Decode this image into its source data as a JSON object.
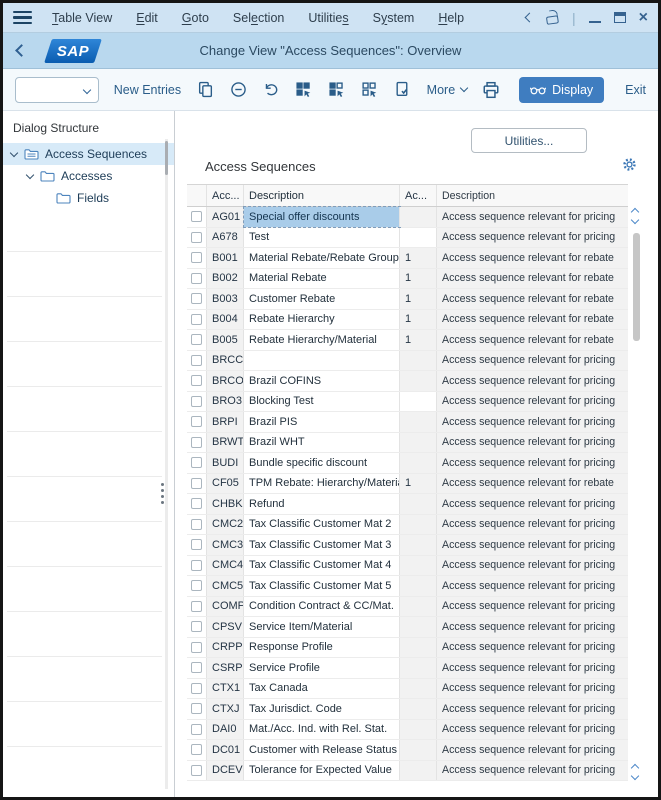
{
  "menu": {
    "items": [
      {
        "label": "Table View",
        "underline_index": 0
      },
      {
        "label": "Edit",
        "underline_index": 0
      },
      {
        "label": "Goto",
        "underline_index": 0
      },
      {
        "label": "Selection",
        "underline_index": 3
      },
      {
        "label": "Utilities",
        "underline_index": 8
      },
      {
        "label": "System",
        "underline_index": 1
      },
      {
        "label": "Help",
        "underline_index": 0
      }
    ]
  },
  "titlebar": {
    "logo_text": "SAP",
    "title": "Change View \"Access Sequences\": Overview"
  },
  "toolbar": {
    "combo_value": "",
    "new_entries_label": "New Entries",
    "icons": [
      "copy-icon",
      "remove-row-icon",
      "undo-icon",
      "select-all-icon",
      "select-block-icon",
      "deselect-all-icon",
      "check-entries-icon"
    ],
    "more_label": "More",
    "display_label": "Display",
    "exit_label": "Exit"
  },
  "sidebar": {
    "header": "Dialog Structure",
    "tree": [
      {
        "label": "Access Sequences",
        "level": 0,
        "expanded": true,
        "selected": true,
        "icon": "cluster-folder-icon"
      },
      {
        "label": "Accesses",
        "level": 1,
        "expanded": true,
        "icon": "folder-icon"
      },
      {
        "label": "Fields",
        "level": 2,
        "expanded": false,
        "icon": "folder-icon"
      }
    ]
  },
  "main": {
    "utilities_button_label": "Utilities...",
    "section_title": "Access Sequences",
    "table": {
      "columns": [
        "",
        "Acc...",
        "Description",
        "Ac...",
        "Description"
      ],
      "rows": [
        {
          "code": "AG01",
          "desc": "Special offer discounts",
          "ac": "",
          "relevance": "Access sequence relevant for pricing",
          "desc_selected": true
        },
        {
          "code": "A678",
          "desc": "Test",
          "ac": "",
          "relevance": "Access sequence relevant for pricing",
          "ac_editable": true
        },
        {
          "code": "B001",
          "desc": "Material Rebate/Rebate Group",
          "ac": "1",
          "relevance": "Access sequence relevant for rebate"
        },
        {
          "code": "B002",
          "desc": "Material Rebate",
          "ac": "1",
          "relevance": "Access sequence relevant for rebate"
        },
        {
          "code": "B003",
          "desc": "Customer Rebate",
          "ac": "1",
          "relevance": "Access sequence relevant for rebate"
        },
        {
          "code": "B004",
          "desc": "Rebate Hierarchy",
          "ac": "1",
          "relevance": "Access sequence relevant for rebate"
        },
        {
          "code": "B005",
          "desc": "Rebate Hierarchy/Material",
          "ac": "1",
          "relevance": "Access sequence relevant for rebate"
        },
        {
          "code": "BRCC",
          "desc": "",
          "ac": "",
          "relevance": "Access sequence relevant for pricing"
        },
        {
          "code": "BRCO",
          "desc": "Brazil COFINS",
          "ac": "",
          "relevance": "Access sequence relevant for pricing"
        },
        {
          "code": "BRO3",
          "desc": "Blocking Test",
          "ac": "",
          "relevance": "Access sequence relevant for pricing",
          "ac_editable": true
        },
        {
          "code": "BRPI",
          "desc": "Brazil PIS",
          "ac": "",
          "relevance": "Access sequence relevant for pricing"
        },
        {
          "code": "BRWT",
          "desc": "Brazil WHT",
          "ac": "",
          "relevance": "Access sequence relevant for pricing"
        },
        {
          "code": "BUDI",
          "desc": "Bundle specific discount",
          "ac": "",
          "relevance": "Access sequence relevant for pricing"
        },
        {
          "code": "CF05",
          "desc": "TPM Rebate: Hierarchy/Material",
          "ac": "1",
          "relevance": "Access sequence relevant for rebate"
        },
        {
          "code": "CHBK",
          "desc": "Refund",
          "ac": "",
          "relevance": "Access sequence relevant for pricing"
        },
        {
          "code": "CMC2",
          "desc": "Tax Classific Customer Mat 2",
          "ac": "",
          "relevance": "Access sequence relevant for pricing"
        },
        {
          "code": "CMC3",
          "desc": "Tax Classific Customer Mat 3",
          "ac": "",
          "relevance": "Access sequence relevant for pricing"
        },
        {
          "code": "CMC4",
          "desc": "Tax Classific Customer Mat 4",
          "ac": "",
          "relevance": "Access sequence relevant for pricing"
        },
        {
          "code": "CMC5",
          "desc": "Tax Classific Customer Mat 5",
          "ac": "",
          "relevance": "Access sequence relevant for pricing"
        },
        {
          "code": "COMP",
          "desc": "Condition Contract & CC/Mat.",
          "ac": "",
          "relevance": "Access sequence relevant for pricing"
        },
        {
          "code": "CPSV",
          "desc": "Service Item/Material",
          "ac": "",
          "relevance": "Access sequence relevant for pricing"
        },
        {
          "code": "CRPP",
          "desc": "Response Profile",
          "ac": "",
          "relevance": "Access sequence relevant for pricing"
        },
        {
          "code": "CSRP",
          "desc": "Service Profile",
          "ac": "",
          "relevance": "Access sequence relevant for pricing"
        },
        {
          "code": "CTX1",
          "desc": "Tax Canada",
          "ac": "",
          "relevance": "Access sequence relevant for pricing"
        },
        {
          "code": "CTXJ",
          "desc": "Tax Jurisdict. Code",
          "ac": "",
          "relevance": "Access sequence relevant for pricing"
        },
        {
          "code": "DAI0",
          "desc": "Mat./Acc. Ind. with Rel. Stat.",
          "ac": "",
          "relevance": "Access sequence relevant for pricing"
        },
        {
          "code": "DC01",
          "desc": "Customer with Release Status",
          "ac": "",
          "relevance": "Access sequence relevant for pricing"
        },
        {
          "code": "DCEV",
          "desc": "Tolerance for Expected Value",
          "ac": "",
          "relevance": "Access sequence relevant for pricing"
        }
      ]
    }
  },
  "colors": {
    "menubar_bg": "#cfe3f3",
    "titlebar_bg": "#b9d8ee",
    "accent_button": "#3f7dc0",
    "selection_bg": "#a9cce9",
    "tree_selection_bg": "#d7eaf8",
    "readonly_cell_bg": "#f2f2f2",
    "sap_logo_blue": "#0a5cb0"
  }
}
